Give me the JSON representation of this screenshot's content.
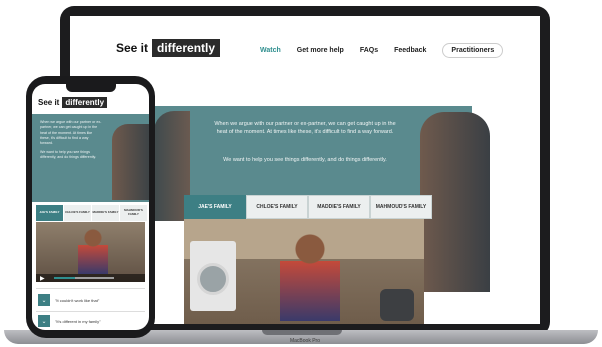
{
  "web": {
    "logo": {
      "see": "See it",
      "diff": "differently"
    },
    "nav": [
      {
        "label": "Watch"
      },
      {
        "label": "Get more help"
      },
      {
        "label": "FAQs"
      },
      {
        "label": "Feedback"
      },
      {
        "label": "Practitioners"
      }
    ],
    "hero_text_1": "When we argue with our partner or ex-partner, we can get caught up in the heat of the moment. At times like these, it's difficult to find a way forward.",
    "hero_text_2": "We want to help you see things differently, and do things differently.",
    "tabs": [
      {
        "label": "JAE'S FAMILY",
        "active": true
      },
      {
        "label": "CHLOE'S FAMILY",
        "active": false
      },
      {
        "label": "MADDIE'S FAMILY",
        "active": false
      },
      {
        "label": "MAHMOUD'S FAMILY",
        "active": false
      }
    ]
  },
  "phone": {
    "logo": {
      "see": "See it",
      "diff": "differently"
    },
    "hero_text_1": "When we argue with our partner or ex-partner, we can get caught up in the heat of the moment. At times like these, it's difficult to find a way forward.",
    "hero_text_2": "We want to help you see things differently, and do things differently.",
    "tabs": [
      {
        "label": "JAE'S FAMILY"
      },
      {
        "label": "CHLOE'S FAMILY"
      },
      {
        "label": "MADDIE'S FAMILY"
      },
      {
        "label": "MAHMOUD'S FAMILY"
      }
    ],
    "questions": [
      {
        "text": "\"It couldn't work like that\""
      },
      {
        "text": "\"It's different in my family\""
      }
    ],
    "video_progress": 0.35
  },
  "device": {
    "brand": "MacBook Pro"
  },
  "colors": {
    "accent": "#3d7f84",
    "hero": "#5a8a8e",
    "nav_active": "#2f8f8f"
  }
}
